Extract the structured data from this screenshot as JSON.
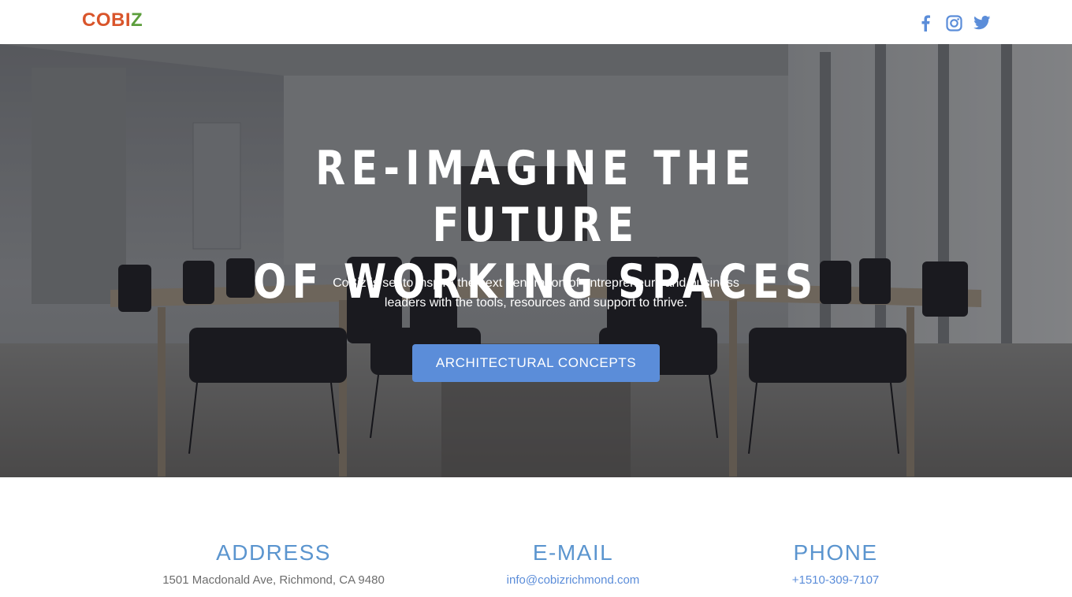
{
  "header": {
    "logo_part1": "COBI",
    "logo_part2": "Z",
    "social": [
      {
        "name": "facebook-icon",
        "color": "#5b8dd9"
      },
      {
        "name": "instagram-icon",
        "color": "#5b8dd9"
      },
      {
        "name": "twitter-icon",
        "color": "#5b8dd9"
      }
    ]
  },
  "hero": {
    "title_line1": "RE-IMAGINE THE FUTURE",
    "title_line2": "OF WORKING SPACES",
    "subtitle_line1": "CoBiz is set to inspire the next generation of entrepreneurs and business",
    "subtitle_line2": "leaders with the tools, resources and support to thrive.",
    "button_label": "ARCHITECTURAL CONCEPTS",
    "background": "conference-room-photo"
  },
  "contact": {
    "address_heading": "ADDRESS",
    "address_value": "1501 Macdonald Ave, Richmond, CA 9480",
    "email_heading": "E-MAIL",
    "email_value": "info@cobizrichmond.com",
    "phone_heading": "PHONE",
    "phone_value": "+1510-309-7107"
  },
  "colors": {
    "logo_orange": "#d9552b",
    "logo_green": "#5c9e3c",
    "accent_blue": "#5b8dd9",
    "heading_blue": "#5b95cf",
    "text_gray": "#6d6d6d"
  }
}
